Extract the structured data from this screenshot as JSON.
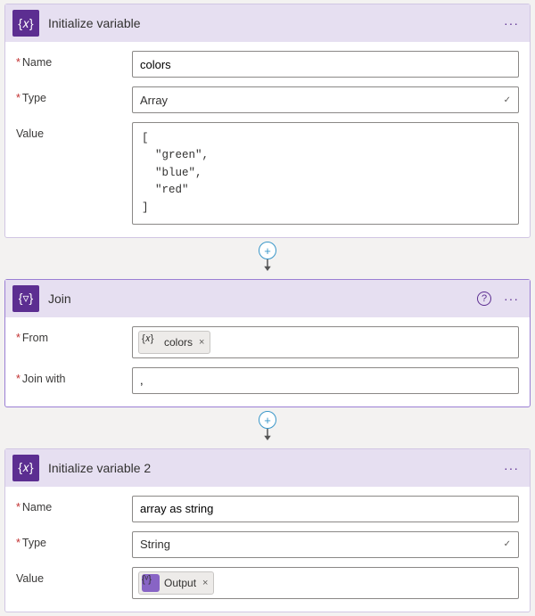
{
  "cards": {
    "init1": {
      "title": "Initialize variable",
      "fields": {
        "name_label": "Name",
        "type_label": "Type",
        "value_label": "Value",
        "name": "colors",
        "type": "Array",
        "value_text": "[\n  \"green\",\n  \"blue\",\n  \"red\"\n]"
      }
    },
    "join": {
      "title": "Join",
      "fields": {
        "from_label": "From",
        "joinwith_label": "Join with",
        "from_token": "colors",
        "joinwith": ","
      }
    },
    "init2": {
      "title": "Initialize variable 2",
      "fields": {
        "name_label": "Name",
        "type_label": "Type",
        "value_label": "Value",
        "name": "array as string",
        "type": "String",
        "value_token": "Output"
      }
    }
  },
  "icons": {
    "variable": "{𝑥}",
    "nabla": "{▿}",
    "output": "{ᵛ}"
  }
}
